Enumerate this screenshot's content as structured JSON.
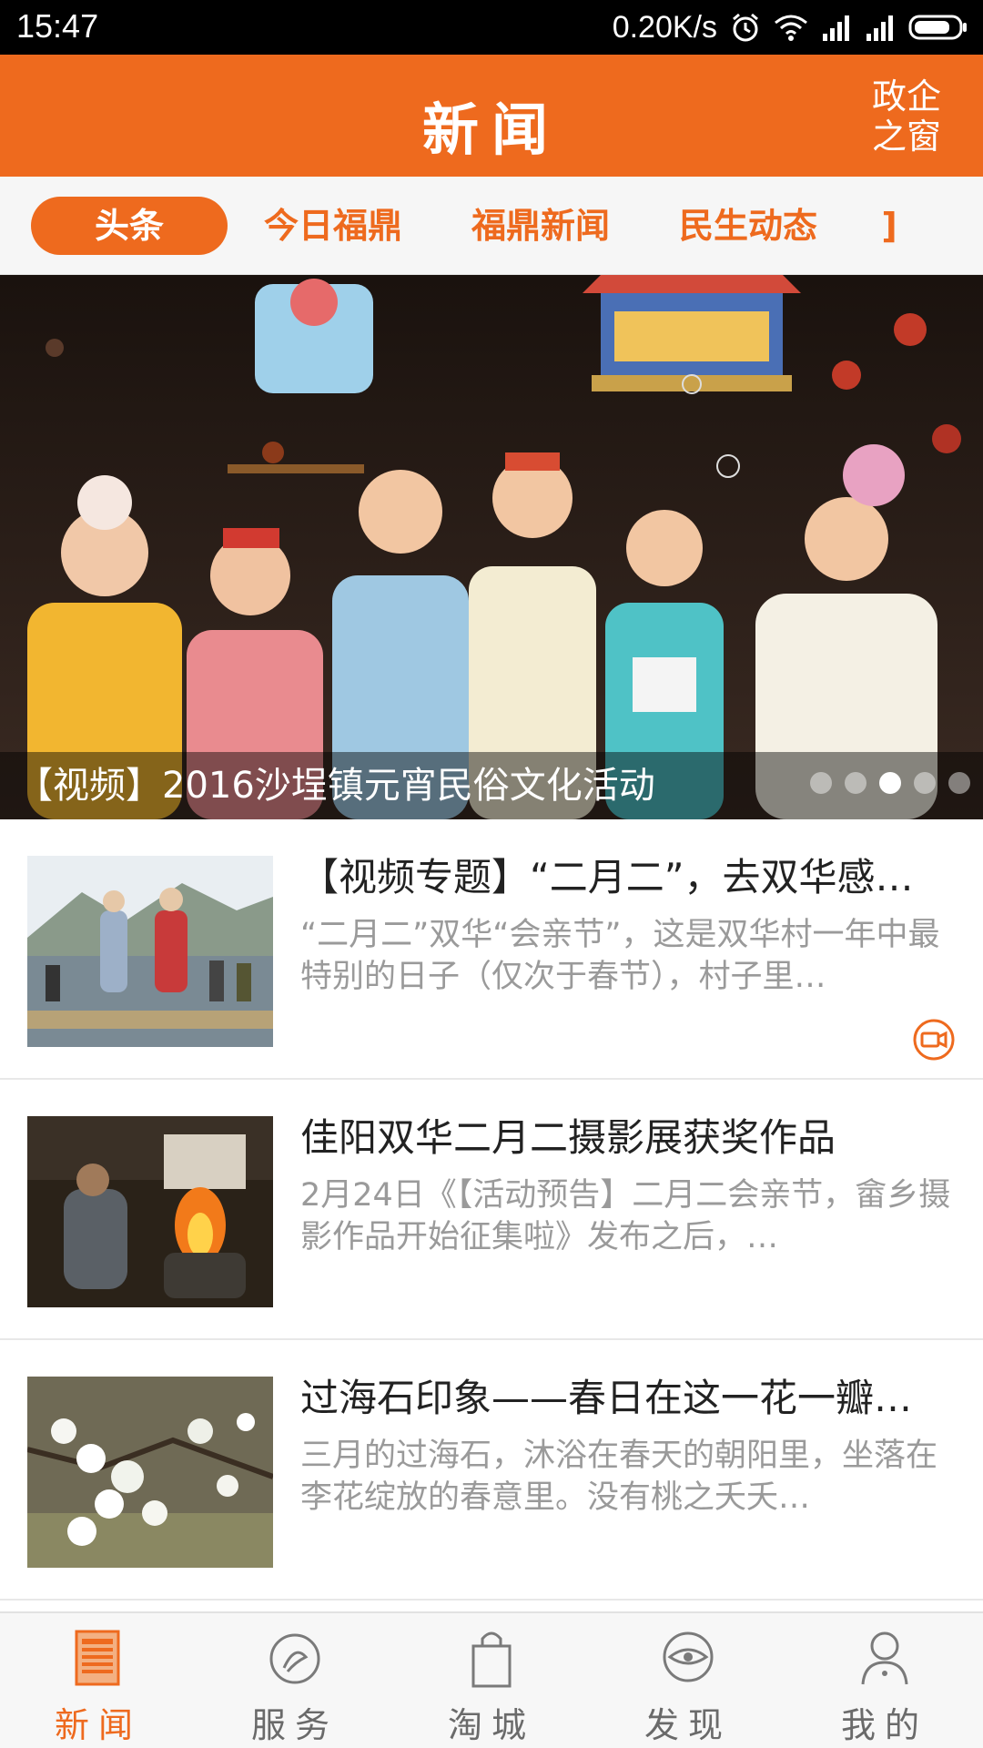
{
  "status_bar": {
    "time": "15:47",
    "net_speed": "0.20K/s",
    "icons": [
      "alarm-icon",
      "wifi-icon",
      "signal-icon",
      "signal-icon",
      "battery-icon"
    ]
  },
  "header": {
    "title": "新闻",
    "right_link": "政企之窗"
  },
  "tabs": [
    {
      "label": "头条",
      "active": true
    },
    {
      "label": "今日福鼎",
      "active": false
    },
    {
      "label": "福鼎新闻",
      "active": false
    },
    {
      "label": "民生动态",
      "active": false
    },
    {
      "label": "]",
      "active": false
    }
  ],
  "banner": {
    "caption": "【视频】2016沙埕镇元宵民俗文化活动",
    "page_count": 5,
    "active_index": 2
  },
  "news": [
    {
      "title": "【视频专题】“二月二”，去双华感…",
      "summary": "“二月二”双华“会亲节”，这是双华村一年中最特别的日子（仅次于春节），村子里…",
      "has_video": true,
      "thumb_icon": "festival-dance-photo"
    },
    {
      "title": "佳阳双华二月二摄影展获奖作品",
      "summary": "2月24日《【活动预告】二月二会亲节，畲乡摄影作品开始征集啦》发布之后，…",
      "has_video": false,
      "thumb_icon": "fire-cooking-photo"
    },
    {
      "title": "过海石印象——春日在这一花一瓣…",
      "summary": "三月的过海石，沐浴在春天的朝阳里，坐落在李花绽放的春意里。没有桃之夭夭…",
      "has_video": false,
      "thumb_icon": "plum-blossom-photo"
    }
  ],
  "bottom_nav": [
    {
      "label": "新闻",
      "icon": "news-icon",
      "active": true
    },
    {
      "label": "服务",
      "icon": "service-icon",
      "active": false
    },
    {
      "label": "淘城",
      "icon": "shopping-bag-icon",
      "active": false
    },
    {
      "label": "发现",
      "icon": "discover-icon",
      "active": false
    },
    {
      "label": "我的",
      "icon": "profile-icon",
      "active": false
    }
  ],
  "colors": {
    "accent": "#ee6a1e",
    "text_primary": "#222222",
    "text_secondary": "#9a9a9a"
  }
}
